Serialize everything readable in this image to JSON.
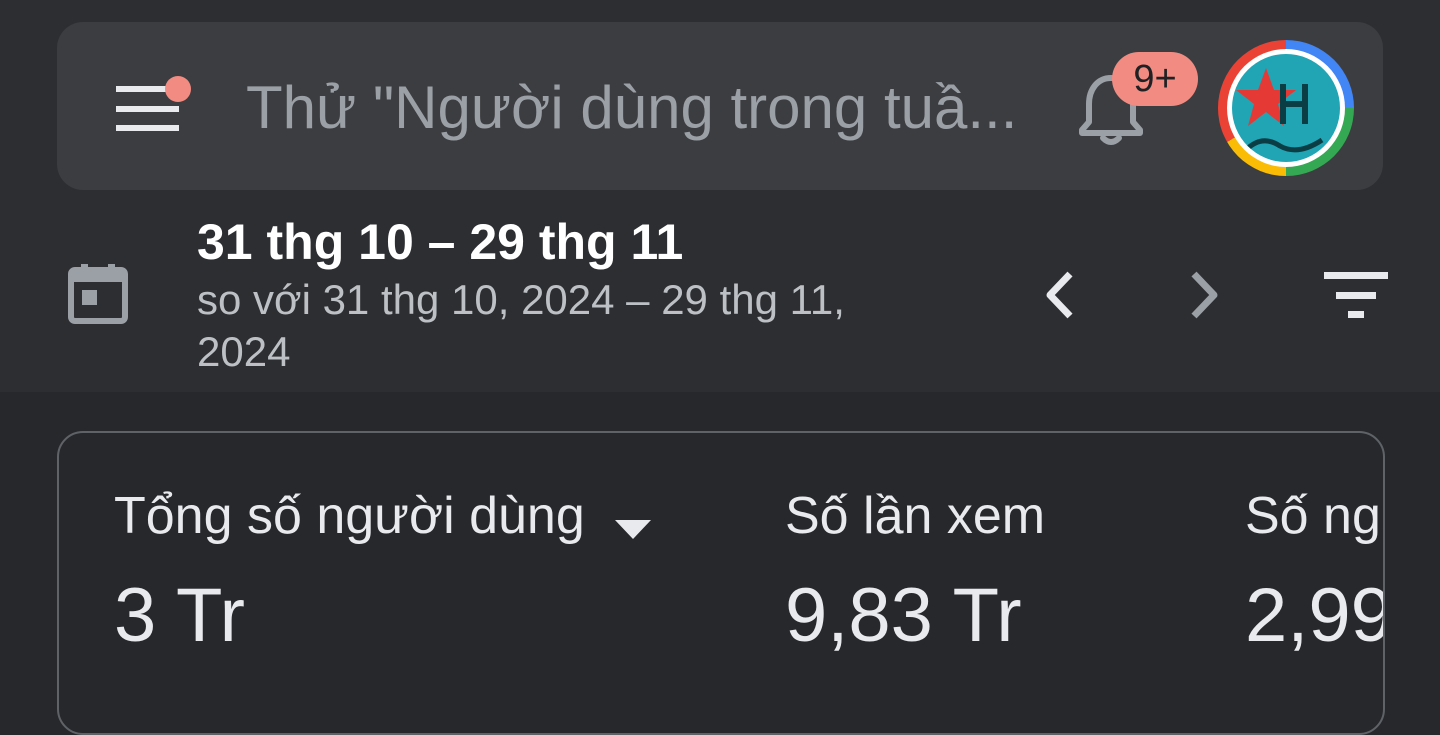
{
  "search": {
    "placeholder_text": "Thử \"Người dùng trong tuầ..."
  },
  "notifications": {
    "badge_count": "9+"
  },
  "date": {
    "range": "31 thg 10 – 29 thg 11",
    "compare_line1": "so với 31 thg 10, 2024 – 29 thg 11,",
    "compare_line2": "2024"
  },
  "metrics": [
    {
      "label": "Tổng số người dùng",
      "value": "3 Tr"
    },
    {
      "label": "Số lần xem",
      "value": "9,83 Tr"
    },
    {
      "label": "Số ng",
      "value": "2,99"
    }
  ],
  "icons": {
    "menu": "menu-icon",
    "bell": "bell-icon",
    "calendar": "calendar-icon",
    "prev": "chevron-left-icon",
    "next": "chevron-right-icon",
    "filter": "filter-icon",
    "dropdown": "caret-down-icon"
  },
  "colors": {
    "background": "#27282c",
    "header": "#2d2e31",
    "search_bar": "#3c3d40",
    "badge": "#f28b82",
    "placeholder": "#9aa0a6"
  }
}
